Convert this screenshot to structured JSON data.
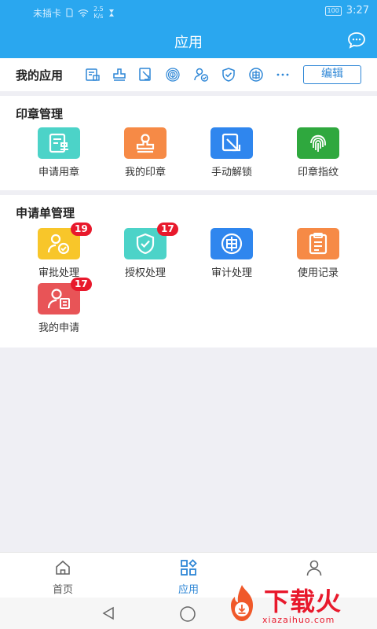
{
  "status_bar": {
    "carrier": "未插卡",
    "speed_value": "2.5",
    "speed_unit": "K/s",
    "battery": "100",
    "time": "3:27"
  },
  "header": {
    "title": "应用",
    "message_icon": "chat-bubble-icon"
  },
  "my_apps": {
    "label": "我的应用",
    "shortcut_icons": [
      "apply-seal-icon",
      "my-seal-icon",
      "manual-unlock-icon",
      "fingerprint-icon",
      "approval-icon",
      "authorization-icon",
      "audit-icon",
      "more-icon"
    ],
    "edit_label": "编辑"
  },
  "seal_management": {
    "title": "印章管理",
    "items": [
      {
        "label": "申请用章",
        "icon": "apply-seal-icon",
        "color": "#4cd3c8"
      },
      {
        "label": "我的印章",
        "icon": "my-seal-icon",
        "color": "#f68a46"
      },
      {
        "label": "手动解锁",
        "icon": "manual-unlock-icon",
        "color": "#2f86ee"
      },
      {
        "label": "印章指纹",
        "icon": "fingerprint-icon",
        "color": "#2fa83e"
      }
    ]
  },
  "request_management": {
    "title": "申请单管理",
    "items": [
      {
        "label": "审批处理",
        "icon": "approval-icon",
        "color": "#f8c62a",
        "badge": "19"
      },
      {
        "label": "授权处理",
        "icon": "authorization-icon",
        "color": "#4cd3c8",
        "badge": "17"
      },
      {
        "label": "审计处理",
        "icon": "audit-icon",
        "color": "#2f86ee"
      },
      {
        "label": "使用记录",
        "icon": "usage-record-icon",
        "color": "#f68a46"
      },
      {
        "label": "我的申请",
        "icon": "my-request-icon",
        "color": "#e85457",
        "badge": "17"
      }
    ]
  },
  "tab_bar": {
    "tabs": [
      {
        "label": "首页",
        "icon": "home-icon"
      },
      {
        "label": "应用",
        "icon": "apps-icon",
        "active": true
      },
      {
        "label": "",
        "icon": "person-icon"
      }
    ],
    "accent": "#2d86d6"
  },
  "watermark": {
    "text": "下载火",
    "url": "xiazaihuo.com"
  },
  "colors": {
    "header_bg": "#2aa7ef",
    "badge": "#e8192c"
  }
}
